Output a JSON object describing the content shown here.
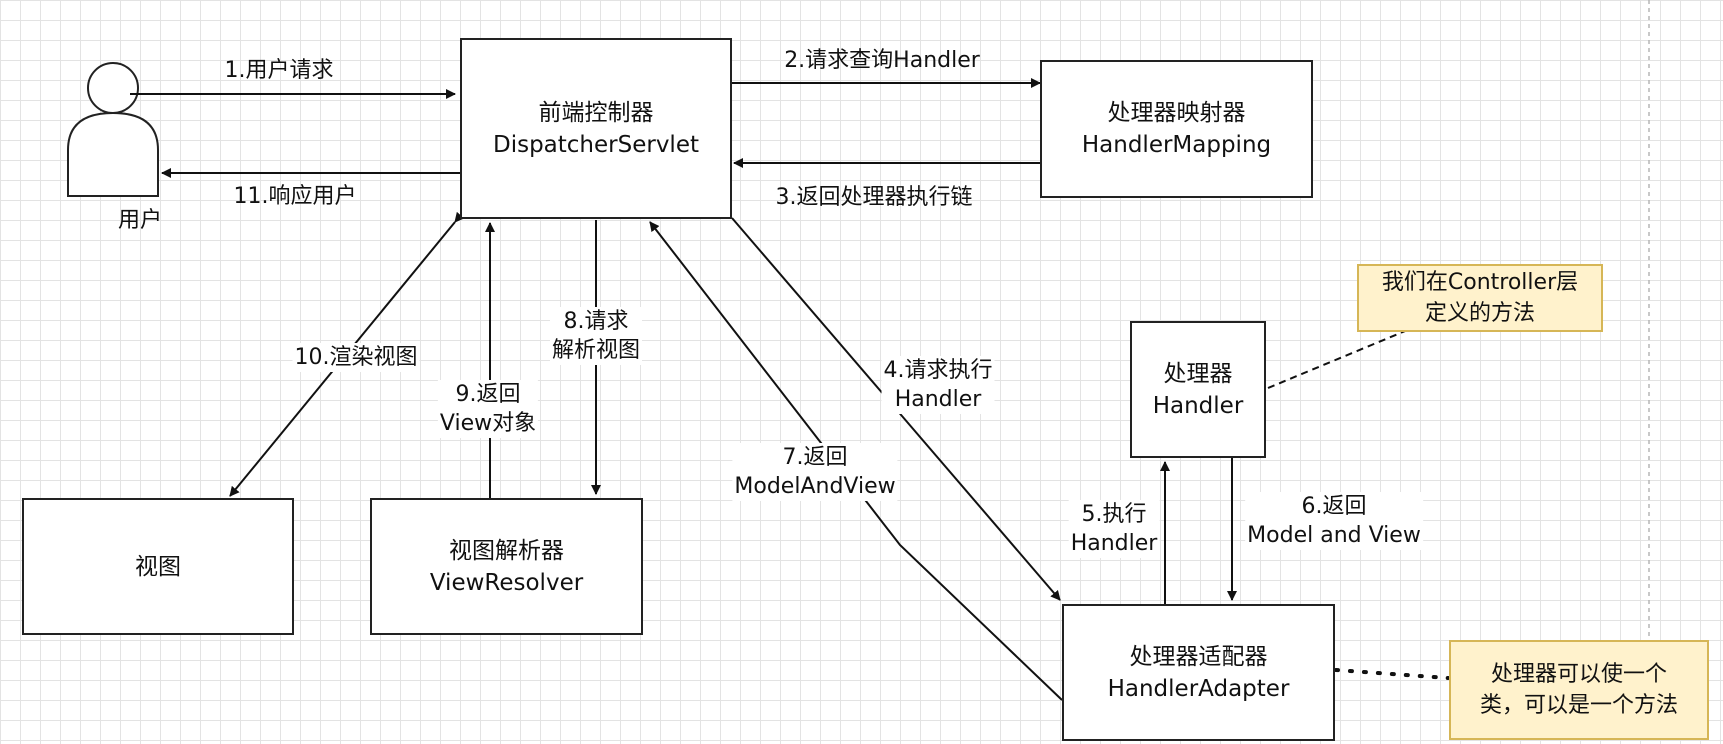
{
  "actor": {
    "label": "用户"
  },
  "nodes": {
    "dispatcher": {
      "line1": "前端控制器",
      "line2": "DispatcherServlet"
    },
    "mapping": {
      "line1": "处理器映射器",
      "line2": "HandlerMapping"
    },
    "handler": {
      "line1": "处理器",
      "line2": "Handler"
    },
    "adapter": {
      "line1": "处理器适配器",
      "line2": "HandlerAdapter"
    },
    "view": {
      "line1": "视图"
    },
    "resolver": {
      "line1": "视图解析器",
      "line2": "ViewResolver"
    }
  },
  "notes": {
    "controller": {
      "line1": "我们在Controller层",
      "line2": "定义的方法"
    },
    "handler_type": {
      "line1": "处理器可以使一个",
      "line2": "类，可以是一个方法"
    }
  },
  "edges": {
    "e1": "1.用户请求",
    "e2": "2.请求查询Handler",
    "e3": "3.返回处理器执行链",
    "e4": [
      "4.请求执行",
      "Handler"
    ],
    "e5": [
      "5.执行",
      "Handler"
    ],
    "e6": [
      "6.返回",
      "Model and View"
    ],
    "e7": [
      "7.返回",
      "ModelAndView"
    ],
    "e8": [
      "8.请求",
      "解析视图"
    ],
    "e9": [
      "9.返回",
      "View对象"
    ],
    "e10": "10.渲染视图",
    "e11": "11.响应用户"
  }
}
